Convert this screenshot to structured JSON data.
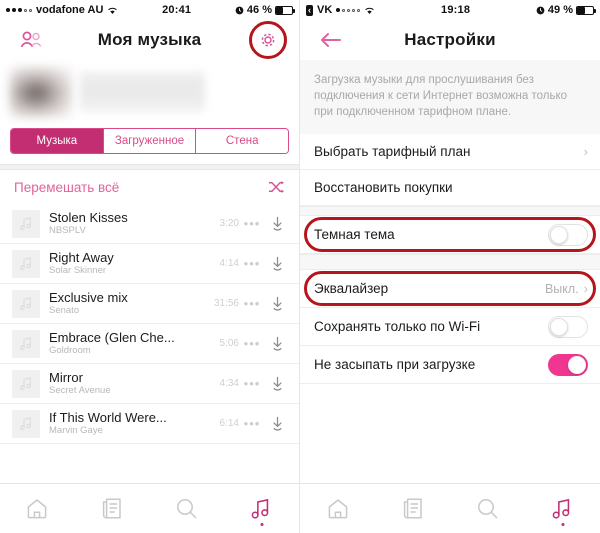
{
  "left": {
    "status": {
      "signal_filled": 3,
      "signal_hollow": 2,
      "carrier": "vodafone AU",
      "wifi_icon": "wifi-icon",
      "time": "20:41",
      "alarm_icon": "alarm-icon",
      "battery": "46 %",
      "battery_level": 46
    },
    "nav": {
      "friends_icon": "friends-icon",
      "title": "Моя музыка",
      "settings_icon": "gear-icon",
      "settings_highlighted": true
    },
    "profile": {
      "avatar": "blurred-avatar",
      "name": "blurred-name"
    },
    "tabs": [
      {
        "label": "Музыка",
        "active": true
      },
      {
        "label": "Загруженное",
        "active": false
      },
      {
        "label": "Стена",
        "active": false
      }
    ],
    "shuffle": {
      "label": "Перемешать всё",
      "icon": "shuffle-icon"
    },
    "tracks": [
      {
        "title": "Stolen Kisses",
        "artist": "NBSPLV",
        "duration": "3:20",
        "more": "•••",
        "download": "download-icon"
      },
      {
        "title": "Right Away",
        "artist": "Solar Skinner",
        "duration": "4:14",
        "more": "•••",
        "download": "download-icon"
      },
      {
        "title": "Exclusive mix",
        "artist": "Senato",
        "duration": "31:56",
        "more": "•••",
        "download": "download-icon"
      },
      {
        "title": "Embrace (Glen Che...",
        "artist": "Goldroom",
        "duration": "5:06",
        "more": "•••",
        "download": "download-icon"
      },
      {
        "title": "Mirror",
        "artist": "Secret Avenue",
        "duration": "4:34",
        "more": "•••",
        "download": "download-icon"
      },
      {
        "title": "If This World Were...",
        "artist": "Marvin Gaye",
        "duration": "6:14",
        "more": "•••",
        "download": "download-icon"
      }
    ],
    "tabbar": [
      {
        "icon": "home-icon",
        "active": false
      },
      {
        "icon": "news-icon",
        "active": false
      },
      {
        "icon": "search-icon",
        "active": false
      },
      {
        "icon": "music-icon",
        "active": true
      }
    ]
  },
  "right": {
    "status": {
      "back_app": "VK",
      "signal_filled": 1,
      "signal_hollow": 4,
      "wifi_icon": "wifi-icon",
      "time": "19:18",
      "alarm_icon": "alarm-icon",
      "battery": "49 %",
      "battery_level": 49
    },
    "nav": {
      "back_icon": "back-arrow-icon",
      "title": "Настройки"
    },
    "note": "Загрузка музыки для прослушивания без подключения к сети Интернет возможна только при подключенном тарифном плане.",
    "rows": [
      {
        "label": "Выбрать тарифный план",
        "type": "chevron",
        "value": "",
        "chevron": "›",
        "highlighted": false
      },
      {
        "label": "Восстановить покупки",
        "type": "plain",
        "value": "",
        "highlighted": false
      },
      {
        "label": "Темная тема",
        "type": "toggle",
        "toggle_on": false,
        "highlighted": true
      },
      {
        "label": "Эквалайзер",
        "type": "chevron",
        "value": "Выкл.",
        "chevron": "›",
        "highlighted": true
      },
      {
        "label": "Сохранять только по Wi-Fi",
        "type": "toggle",
        "toggle_on": false,
        "highlighted": false
      },
      {
        "label": "Не засыпать при загрузке",
        "type": "toggle",
        "toggle_on": true,
        "highlighted": false
      }
    ],
    "tabbar": [
      {
        "icon": "home-icon",
        "active": false
      },
      {
        "icon": "news-icon",
        "active": false
      },
      {
        "icon": "search-icon",
        "active": false
      },
      {
        "icon": "music-icon",
        "active": true
      }
    ]
  },
  "colors": {
    "accent_pink": "#c32d72",
    "toggle_on": "#f0368f",
    "highlight_ring": "#b5161c",
    "link_pink": "#e0649c"
  }
}
